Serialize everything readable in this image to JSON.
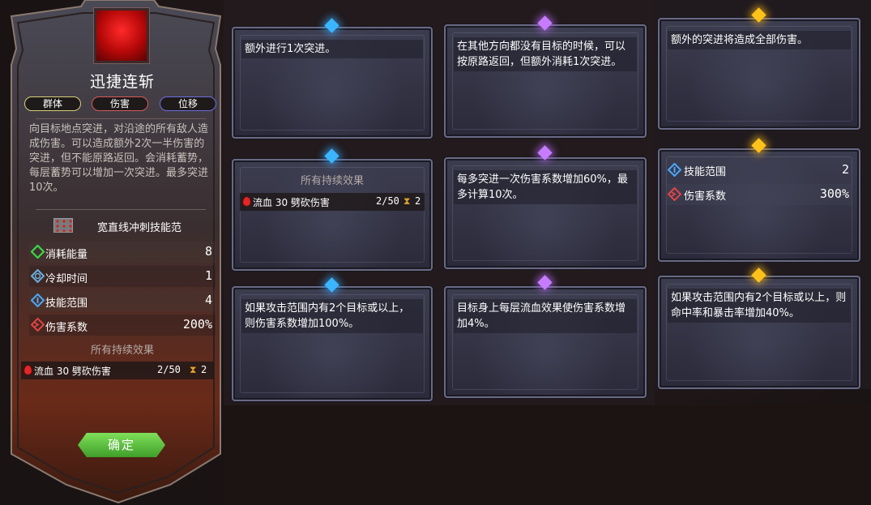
{
  "left_panel": {
    "title": "迅捷连斩",
    "tags": [
      "群体",
      "伤害",
      "位移"
    ],
    "description": "向目标地点突进，对沿途的所有敌人造成伤害。可以造成额外2次一半伤害的突进，但不能原路返回。会消耗蓄势，每层蓄势可以增加一次突进。最多突进10次。",
    "combo_label": "宽直线冲刺技能范",
    "stats": [
      {
        "label": "消耗能量",
        "value": "8",
        "icon": "energy-icon",
        "color": "#3ad84a"
      },
      {
        "label": "冷却时间",
        "value": "1",
        "icon": "cooldown-icon",
        "color": "#6cb0e0"
      },
      {
        "label": "技能范围",
        "value": "4",
        "icon": "range-icon",
        "color": "#4aa8ff"
      },
      {
        "label": "伤害系数",
        "value": "200%",
        "icon": "damage-icon",
        "color": "#e04444"
      }
    ],
    "effects_title": "所有持续效果",
    "effect": {
      "name": "流血 30 劈砍伤害",
      "stack": "2/50",
      "duration": "2"
    },
    "confirm_label": "确定"
  },
  "cards": [
    {
      "id": "blue-1",
      "gem": "blue",
      "text": "额外进行1次突进。"
    },
    {
      "id": "purple-1",
      "gem": "purple",
      "text": "在其他方向都没有目标的时候，可以按原路返回，但额外消耗1次突进。"
    },
    {
      "id": "gold-1",
      "gem": "gold",
      "text": "额外的突进将造成全部伤害。"
    },
    {
      "id": "blue-2",
      "gem": "blue",
      "effects_title": "所有持续效果",
      "effect": {
        "name": "流血 30 劈砍伤害",
        "stack": "2/50",
        "duration": "2"
      }
    },
    {
      "id": "purple-2",
      "gem": "purple",
      "text": "每多突进一次伤害系数增加60%，最多计算10次。"
    },
    {
      "id": "gold-2",
      "gem": "gold",
      "stats": [
        {
          "label": "技能范围",
          "value": "2",
          "icon": "range-icon"
        },
        {
          "label": "伤害系数",
          "value": "300%",
          "icon": "damage-icon"
        }
      ]
    },
    {
      "id": "blue-3",
      "gem": "blue",
      "text": "如果攻击范围内有2个目标或以上，则伤害系数增加100%。"
    },
    {
      "id": "purple-3",
      "gem": "purple",
      "text": "目标身上每层流血效果使伤害系数增加4%。"
    },
    {
      "id": "gold-3",
      "gem": "gold",
      "text": "如果攻击范围内有2个目标或以上，则命中率和暴击率增加40%。"
    }
  ],
  "colors": {
    "gem_blue": "#3ab5ff",
    "gem_purple": "#c77bff",
    "gem_gold": "#ffc21a",
    "confirm_green": "#5ac43e"
  }
}
